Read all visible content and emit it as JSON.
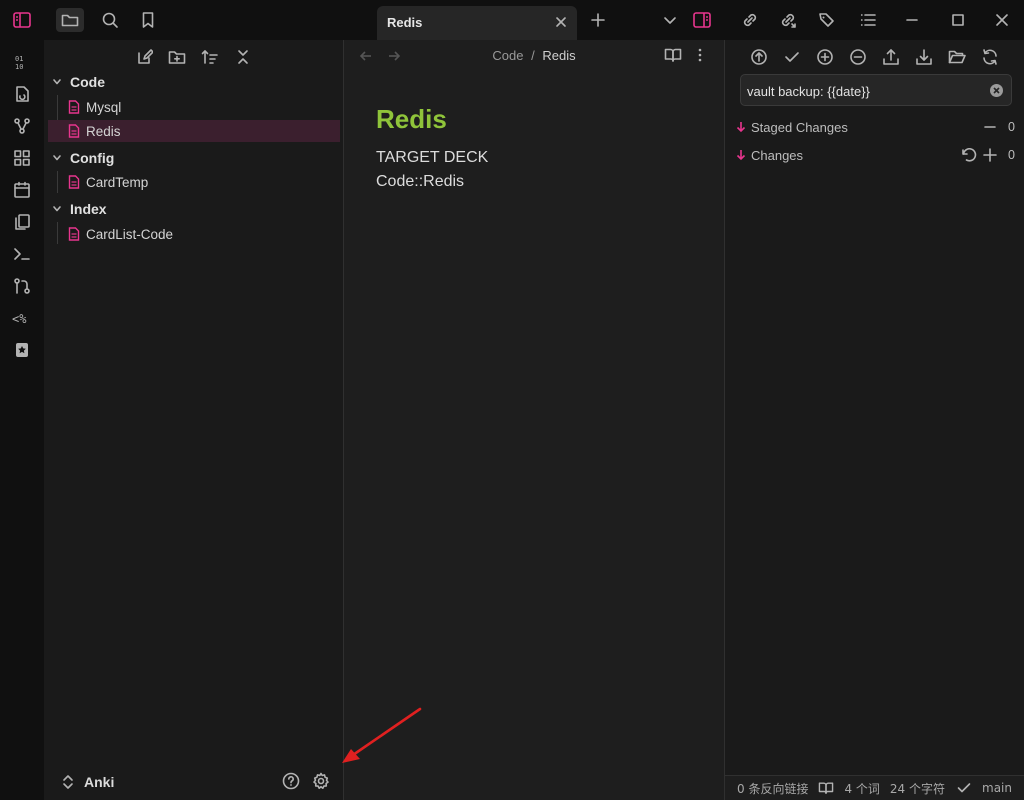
{
  "tab": {
    "title": "Redis"
  },
  "sidebar": {
    "tree": [
      {
        "type": "folder",
        "label": "Code"
      },
      {
        "type": "file",
        "label": "Mysql"
      },
      {
        "type": "file",
        "label": "Redis",
        "selected": true
      },
      {
        "type": "folder",
        "label": "Config"
      },
      {
        "type": "file",
        "label": "CardTemp"
      },
      {
        "type": "folder",
        "label": "Index"
      },
      {
        "type": "file",
        "label": "CardList-Code"
      }
    ],
    "vault_name": "Anki"
  },
  "editor": {
    "breadcrumb": {
      "parent": "Code",
      "separator": "/",
      "current": "Redis"
    },
    "note_title": "Redis",
    "lines": [
      "TARGET DECK",
      "Code::Redis"
    ]
  },
  "git_panel": {
    "commit_message": "vault backup: {{date}}",
    "staged_label": "Staged Changes",
    "staged_count": "0",
    "changes_label": "Changes",
    "changes_count": "0"
  },
  "statusbar": {
    "backlinks": "0 条反向链接",
    "words": "4 个词",
    "chars": "24 个字符",
    "branch": "main"
  },
  "colors": {
    "accent": "#e8358e",
    "title_green": "#8fc43a",
    "selected_bg": "#3b1f2e",
    "annotation_red": "#e02020"
  }
}
